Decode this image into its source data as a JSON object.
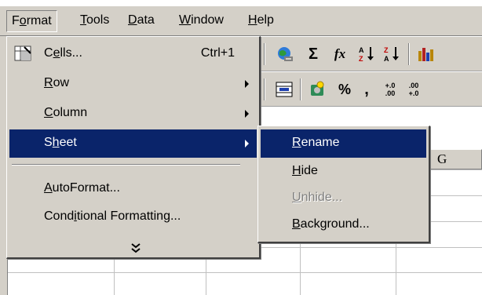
{
  "menubar": {
    "items": [
      {
        "label": "Format",
        "underline_index": 1,
        "open": true
      },
      {
        "label": "Tools",
        "underline_index": 0
      },
      {
        "label": "Data",
        "underline_index": 0
      },
      {
        "label": "Window",
        "underline_index": 0
      },
      {
        "label": "Help",
        "underline_index": 0
      }
    ]
  },
  "format_menu": {
    "items": [
      {
        "label": "Cells...",
        "underline_index": 1,
        "shortcut": "Ctrl+1",
        "icon": "format-cells-icon"
      },
      {
        "label": "Row",
        "underline_index": 0,
        "submenu": true
      },
      {
        "label": "Column",
        "underline_index": 0,
        "submenu": true
      },
      {
        "label": "Sheet",
        "underline_index": 1,
        "submenu": true,
        "highlighted": true
      },
      {
        "label": "AutoFormat...",
        "underline_index": 0
      },
      {
        "label": "Conditional Formatting...",
        "underline_index": 4
      }
    ],
    "expand_glyph": "⌄⌄"
  },
  "sheet_submenu": {
    "items": [
      {
        "label": "Rename",
        "underline_index": 0,
        "highlighted": true
      },
      {
        "label": "Hide",
        "underline_index": 0
      },
      {
        "label": "Unhide...",
        "underline_index": 0,
        "disabled": true
      },
      {
        "label": "Background...",
        "underline_index": 0
      }
    ]
  },
  "toolbar1": {
    "icons": [
      "web-globe-icon",
      "autosum-icon",
      "function-icon",
      "sort-ascending-icon",
      "sort-descending-icon",
      "chart-wizard-icon"
    ],
    "glyphs": {
      "sum": "Σ",
      "function": "fx",
      "sort_asc_top": "A",
      "sort_asc_bottom": "Z",
      "sort_desc_top": "Z",
      "sort_desc_bottom": "A"
    }
  },
  "toolbar2": {
    "icons": [
      "merge-center-icon",
      "currency-icon",
      "percent-icon",
      "comma-icon",
      "increase-decimal-icon",
      "decrease-decimal-icon"
    ],
    "glyphs": {
      "percent": "%",
      "comma": ",",
      "inc_top": "+.0",
      "inc_bottom": ".00",
      "dec_top": ".00",
      "dec_bottom": "+.0"
    }
  },
  "column_header": {
    "label": "G"
  },
  "colors": {
    "menu_bg": "#d4d0c8",
    "highlight": "#0a246a",
    "highlight_text": "#ffffff",
    "disabled_text": "#808080"
  }
}
